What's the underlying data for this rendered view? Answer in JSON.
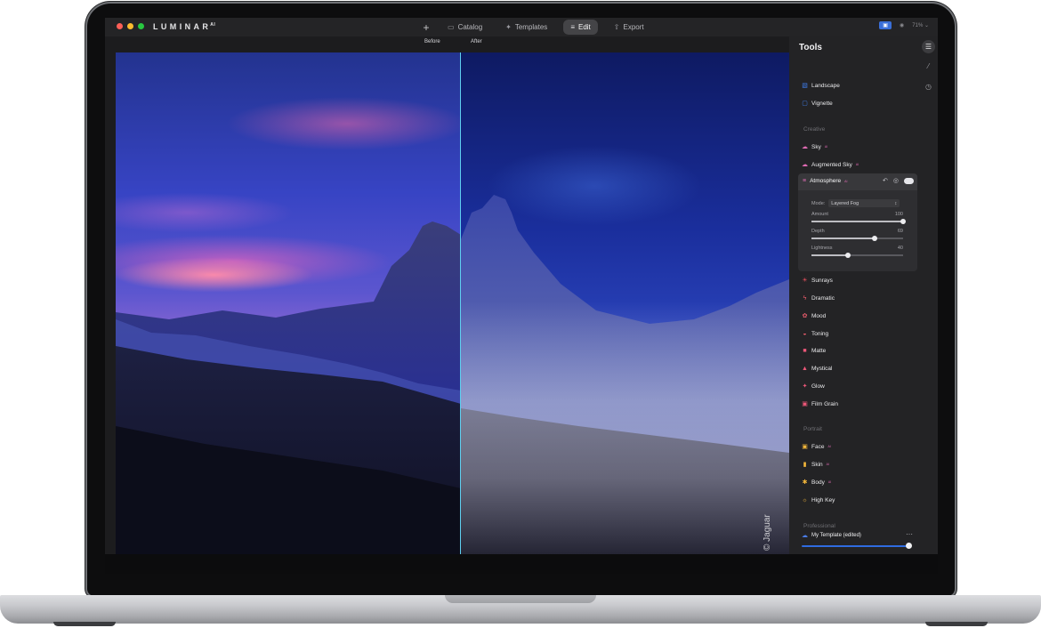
{
  "window": {
    "logo": "LUMINAR",
    "logo_sup": "AI"
  },
  "topnav": [
    {
      "id": "add",
      "label": "+"
    },
    {
      "id": "catalog",
      "label": "Catalog",
      "icon": "folder-icon"
    },
    {
      "id": "templates",
      "label": "Templates",
      "icon": "templates-icon"
    },
    {
      "id": "edit",
      "label": "Edit",
      "icon": "sliders-icon",
      "active": true
    },
    {
      "id": "export",
      "label": "Export",
      "icon": "share-icon"
    }
  ],
  "topright": {
    "zoom": "71%"
  },
  "compare": {
    "before": "Before",
    "after": "After"
  },
  "photo": {
    "watermark": "© Jaguar"
  },
  "panel": {
    "title": "Tools",
    "tools_top": [
      {
        "label": "Landscape",
        "icon": "landscape-icon",
        "color": "#3f7ff0"
      },
      {
        "label": "Vignette",
        "icon": "vignette-icon",
        "color": "#3f7ff0"
      }
    ],
    "section_creative": "Creative",
    "tools_creative_a": [
      {
        "label": "Sky",
        "ai": "AI",
        "icon": "cloud-icon",
        "color": "#e06bb4"
      },
      {
        "label": "Augmented Sky",
        "ai": "AI",
        "icon": "cloud-icon",
        "color": "#e06bb4"
      }
    ],
    "atmosphere": {
      "label": "Atmosphere",
      "ai": "AI",
      "mode_label": "Mode:",
      "mode_value": "Layered Fog",
      "sliders": [
        {
          "label": "Amount",
          "value": "100",
          "fraction": 1.0
        },
        {
          "label": "Depth",
          "value": "69",
          "fraction": 0.69
        },
        {
          "label": "Lightness",
          "value": "40",
          "fraction": 0.4
        }
      ]
    },
    "tools_creative_b": [
      {
        "label": "Sunrays",
        "icon": "sun-icon",
        "color": "#e64f5c"
      },
      {
        "label": "Dramatic",
        "icon": "bolt-icon",
        "color": "#e85c6b"
      },
      {
        "label": "Mood",
        "icon": "mood-icon",
        "color": "#e85c6b"
      },
      {
        "label": "Toning",
        "icon": "toning-icon",
        "color": "#e85c6b"
      },
      {
        "label": "Matte",
        "icon": "matte-icon",
        "color": "#ec5778"
      },
      {
        "label": "Mystical",
        "icon": "mystical-icon",
        "color": "#ec5778"
      },
      {
        "label": "Glow",
        "icon": "glow-icon",
        "color": "#ec5778"
      },
      {
        "label": "Film Grain",
        "icon": "film-grain-icon",
        "color": "#ec5778"
      }
    ],
    "section_portrait": "Portrait",
    "tools_portrait": [
      {
        "label": "Face",
        "ai": "AI",
        "icon": "face-icon",
        "color": "#f2b63a"
      },
      {
        "label": "Skin",
        "ai": "AI",
        "icon": "skin-icon",
        "color": "#f2b63a"
      },
      {
        "label": "Body",
        "ai": "AI",
        "icon": "body-icon",
        "color": "#f2b63a"
      },
      {
        "label": "High Key",
        "icon": "high-key-icon",
        "color": "#f2b63a"
      }
    ],
    "section_professional": "Professional",
    "preset": {
      "label": "My Template (edited)",
      "more": "···",
      "amount": 1.0
    }
  }
}
